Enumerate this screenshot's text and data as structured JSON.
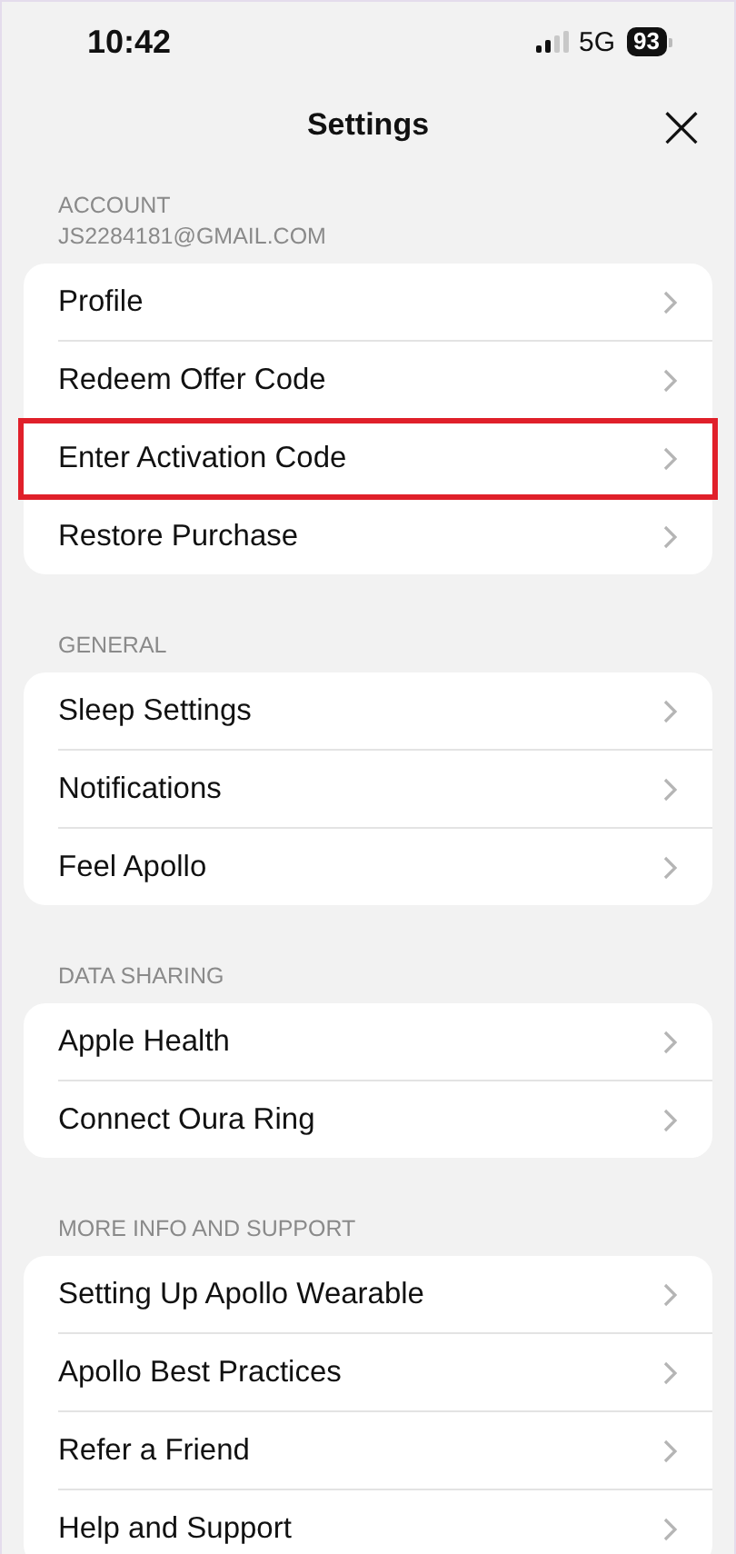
{
  "status_bar": {
    "time": "10:42",
    "network": "5G",
    "battery": "93"
  },
  "header": {
    "title": "Settings",
    "close": "×"
  },
  "sections": [
    {
      "title": "ACCOUNT",
      "subtitle": "JS2284181@GMAIL.COM",
      "items": [
        {
          "label": "Profile",
          "highlighted": false
        },
        {
          "label": "Redeem Offer Code",
          "highlighted": false
        },
        {
          "label": "Enter Activation Code",
          "highlighted": true
        },
        {
          "label": "Restore Purchase",
          "highlighted": false
        }
      ]
    },
    {
      "title": "GENERAL",
      "items": [
        {
          "label": "Sleep Settings",
          "highlighted": false
        },
        {
          "label": "Notifications",
          "highlighted": false
        },
        {
          "label": "Feel Apollo",
          "highlighted": false
        }
      ]
    },
    {
      "title": "DATA SHARING",
      "items": [
        {
          "label": "Apple Health",
          "highlighted": false
        },
        {
          "label": "Connect Oura Ring",
          "highlighted": false
        }
      ]
    },
    {
      "title": "MORE INFO AND SUPPORT",
      "items": [
        {
          "label": "Setting Up Apollo Wearable",
          "highlighted": false
        },
        {
          "label": "Apollo Best Practices",
          "highlighted": false
        },
        {
          "label": "Refer a Friend",
          "highlighted": false
        },
        {
          "label": "Help and Support",
          "highlighted": false
        }
      ]
    }
  ]
}
